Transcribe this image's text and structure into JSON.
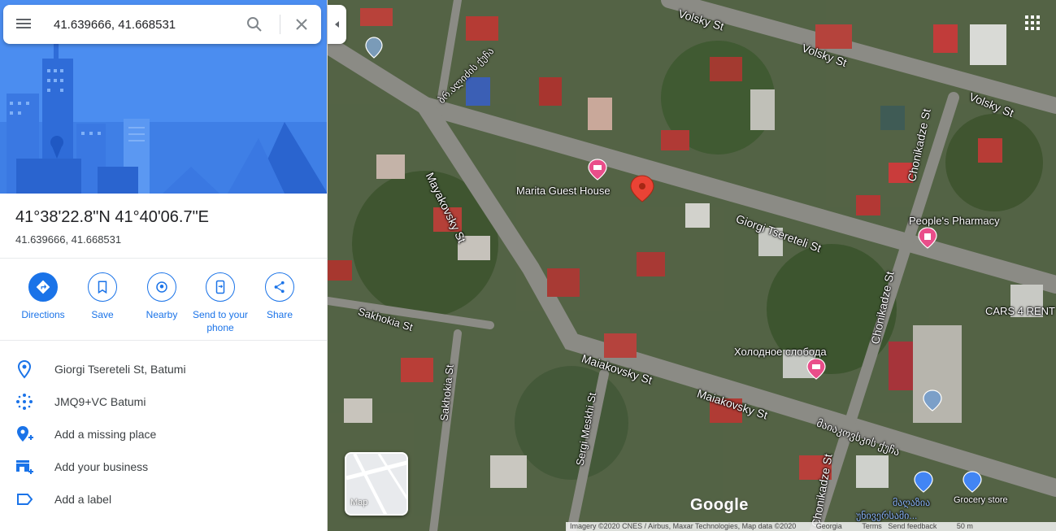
{
  "search": {
    "value": "41.639666, 41.668531"
  },
  "place": {
    "title": "41°38'22.8\"N 41°40'06.7\"E",
    "subtitle": "41.639666, 41.668531"
  },
  "actions": [
    {
      "label": "Directions",
      "icon": "directions-icon"
    },
    {
      "label": "Save",
      "icon": "bookmark-icon"
    },
    {
      "label": "Nearby",
      "icon": "nearby-icon"
    },
    {
      "label": "Send to your phone",
      "icon": "send-to-phone-icon"
    },
    {
      "label": "Share",
      "icon": "share-icon"
    }
  ],
  "info": [
    {
      "text": "Giorgi Tsereteli St, Batumi",
      "icon": "location-pin-icon"
    },
    {
      "text": "JMQ9+VC Batumi",
      "icon": "plus-code-icon"
    },
    {
      "text": "Add a missing place",
      "icon": "add-place-icon"
    },
    {
      "text": "Add your business",
      "icon": "add-business-icon"
    },
    {
      "text": "Add a label",
      "icon": "label-icon"
    }
  ],
  "map": {
    "streets": {
      "volsky1": "Volsky St",
      "volsky2": "Volsky St",
      "volsky3": "Volsky St",
      "georgian_top": "ბრ.ალიძის ქუჩა",
      "mayakovsky": "Mayakovsky St",
      "tsereteli": "Giorgi Tsereteli St",
      "chonikadze1": "Chonikadze St",
      "chonikadze2": "Chonikadze St",
      "chonikadze3": "Chonikadze St",
      "sakhokia1": "Sakhokia St",
      "sakhokia2": "Sakhokia St",
      "maiakovsky1": "Maiakovsky St",
      "maiakovsky2": "Maiakovsky St",
      "sergi_meskhi": "Sergi Meskhi St",
      "georgian_bottom": "მაიაკოვსკის ქუჩა"
    },
    "pois": {
      "marita": "Marita Guest House",
      "pharmacy": "People's Pharmacy",
      "cars": "CARS 4 RENT",
      "kholodnoe": "Холодное слобода",
      "grocery": "Grocery store",
      "georgian_shop1": "მაღაზია",
      "georgian_shop2": "უნივერსამი..."
    },
    "layer_label": "Map",
    "logo": "Google",
    "attribution": {
      "imagery": "Imagery ©2020 CNES / Airbus, Maxar Technologies, Map data ©2020",
      "country": "Georgia",
      "terms": "Terms",
      "feedback": "Send feedback",
      "scale": "50 m"
    },
    "colors": {
      "accent": "#1a73e8",
      "pin": "#ea4335",
      "poi_pink": "#e94e8a",
      "poi_blue": "#4285f4"
    }
  }
}
